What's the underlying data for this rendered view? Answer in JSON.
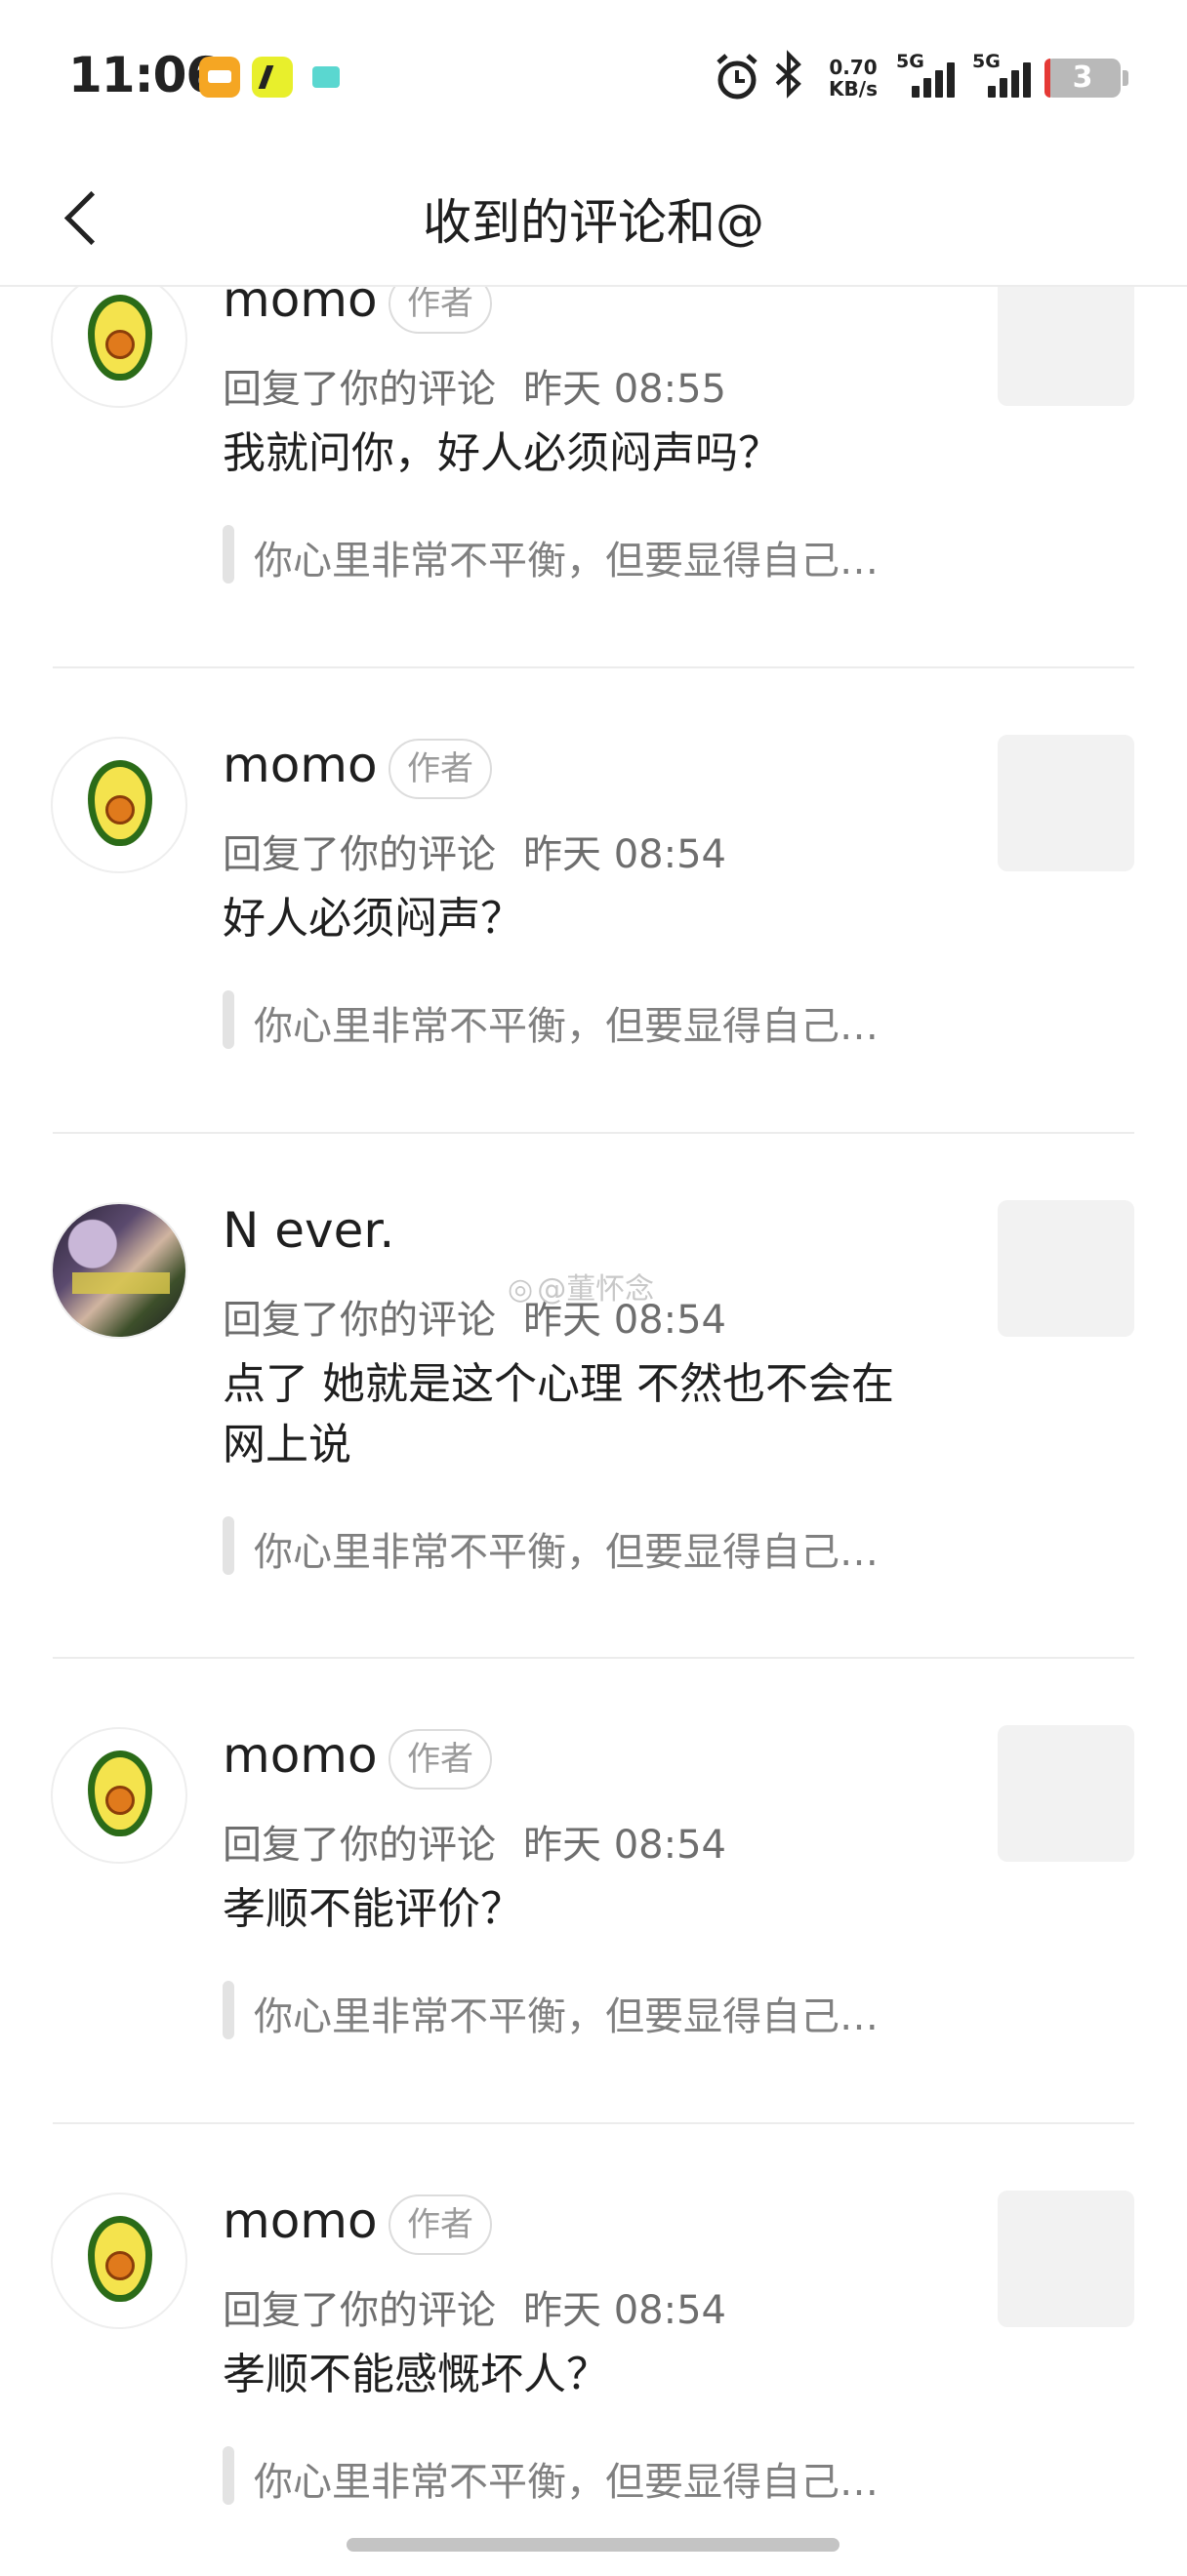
{
  "status_bar": {
    "time": "11:06",
    "net_speed_value": "0.70",
    "net_speed_unit": "KB/s",
    "sim1_label": "5G",
    "sim2_label": "5G",
    "battery_level": "3",
    "icons": [
      "app-orange-icon",
      "app-yellow-icon",
      "app-teal-icon",
      "alarm-icon",
      "bluetooth-icon",
      "signal-icon",
      "battery-icon"
    ]
  },
  "nav": {
    "title": "收到的评论和@"
  },
  "list": {
    "items": [
      {
        "name": "momo",
        "badge": "作者",
        "action": "回复了你的评论",
        "time": "昨天 08:55",
        "content": "我就问你，好人必须闷声吗？",
        "quote": "你心里非常不平衡，但要显得自己…",
        "avatar": "avocado"
      },
      {
        "name": "momo",
        "badge": "作者",
        "action": "回复了你的评论",
        "time": "昨天 08:54",
        "content": "好人必须闷声？",
        "quote": "你心里非常不平衡，但要显得自己…",
        "avatar": "avocado"
      },
      {
        "name": "N ever.",
        "badge": "",
        "action": "回复了你的评论",
        "time": "昨天 08:54",
        "content": "点了 她就是这个心理 不然也不会在网上说",
        "quote": "你心里非常不平衡，但要显得自己…",
        "avatar": "photo"
      },
      {
        "name": "momo",
        "badge": "作者",
        "action": "回复了你的评论",
        "time": "昨天 08:54",
        "content": "孝顺不能评价？",
        "quote": "你心里非常不平衡，但要显得自己…",
        "avatar": "avocado"
      },
      {
        "name": "momo",
        "badge": "作者",
        "action": "回复了你的评论",
        "time": "昨天 08:54",
        "content": "孝顺不能感慨坏人？",
        "quote": "你心里非常不平衡，但要显得自己…",
        "avatar": "avocado"
      }
    ]
  },
  "watermark": "@董怀念"
}
